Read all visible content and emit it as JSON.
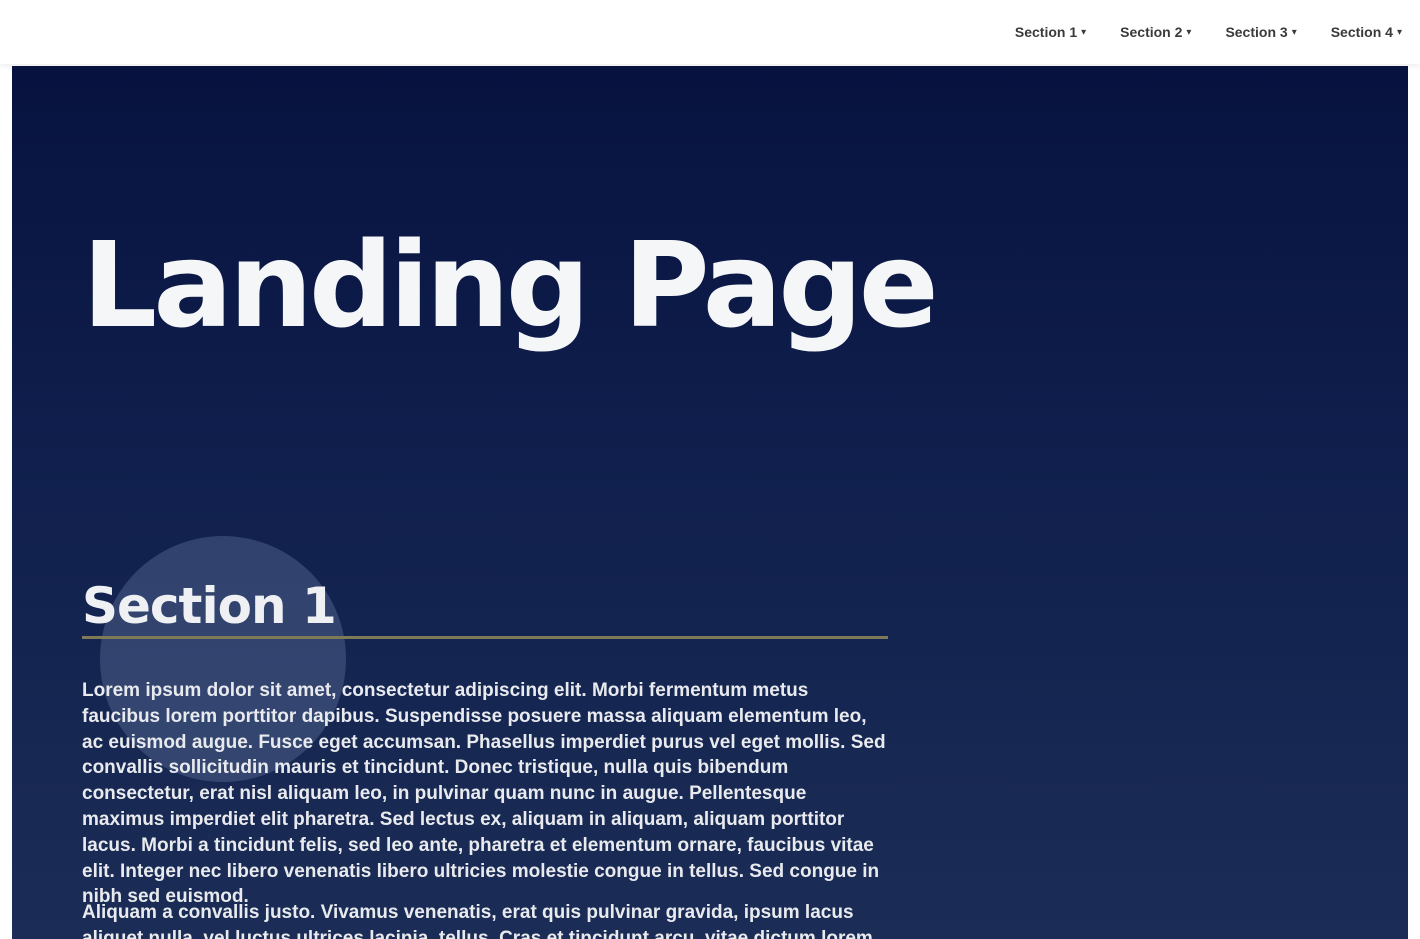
{
  "nav": {
    "items": [
      {
        "label": "Section 1"
      },
      {
        "label": "Section 2"
      },
      {
        "label": "Section 3"
      },
      {
        "label": "Section 4"
      }
    ]
  },
  "hero": {
    "title": "Landing Page"
  },
  "section": {
    "heading": "Section 1",
    "paragraphs": [
      "Lorem ipsum dolor sit amet, consectetur adipiscing elit. Morbi fermentum metus faucibus lorem porttitor dapibus. Suspendisse posuere massa aliquam elementum leo, ac euismod augue. Fusce eget accumsan. Phasellus imperdiet purus vel eget mollis. Sed convallis sollicitudin mauris et tincidunt. Donec tristique, nulla quis bibendum consectetur, erat nisl aliquam leo, in pulvinar quam nunc in augue. Pellentesque maximus imperdiet elit pharetra. Sed lectus ex, aliquam in aliquam, aliquam porttitor lacus. Morbi a tincidunt felis, sed leo ante, pharetra et elementum ornare, faucibus vitae elit. Integer nec libero venenatis libero ultricies molestie congue in tellus. Sed congue in nibh sed euismod.",
      "Aliquam a convallis justo. Vivamus venenatis, erat quis pulvinar gravida, ipsum lacus aliquet nulla, vel luctus ultrices lacinia, tellus. Cras et tincidunt arcu, vitae dictum lorem tincidunt. Vestibulum interdum."
    ]
  }
}
